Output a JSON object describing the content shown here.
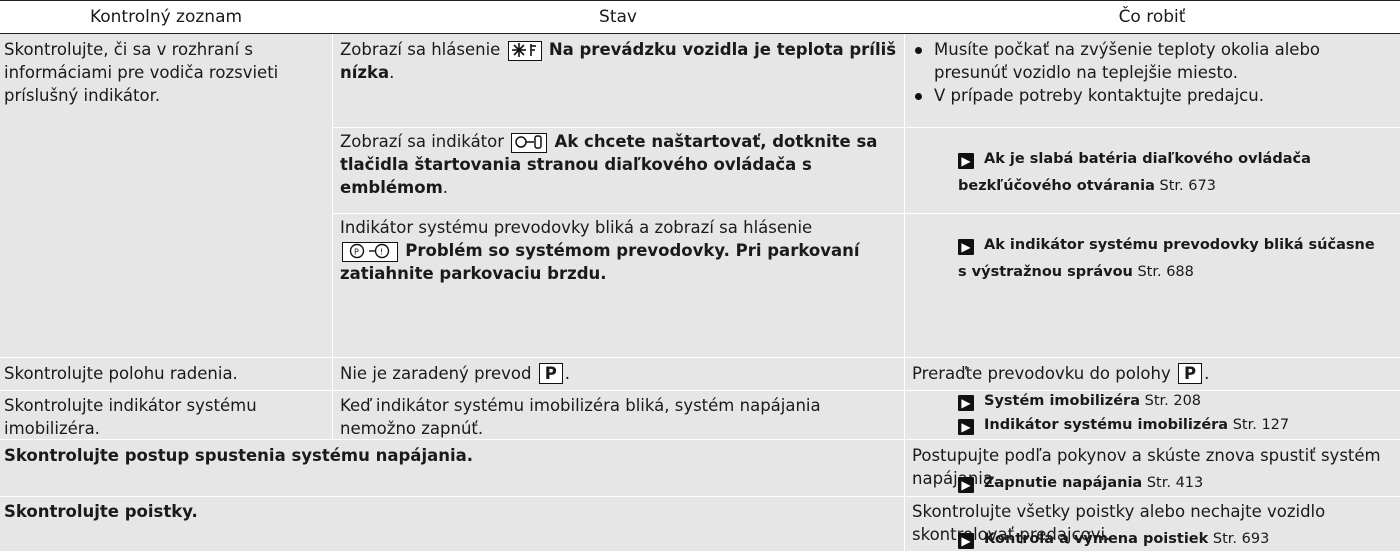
{
  "header": {
    "col1": "Kontrolný zoznam",
    "col2": "Stav",
    "col3": "Čo robiť"
  },
  "row1": {
    "check": "Skontrolujte, či sa v rozhraní s informáciami pre vodiča rozsvieti príslušný indikátor.",
    "sub1": {
      "state_prefix": "Zobrazí sa hlásenie",
      "state_bold": "Na prevádzku vozidla je teplota príliš nízka",
      "state_suffix": ".",
      "action1": "Musíte počkať na zvýšenie teploty okolia alebo presunúť vozidlo na teplejšie miesto.",
      "action2": "V prípade potreby kontaktujte predajcu."
    },
    "sub2": {
      "state_prefix": "Zobrazí sa indikátor",
      "state_bold": "Ak chcete naštartovať, dotknite sa tlačidla štartovania stranou diaľkového ovládača s emblémom",
      "state_suffix": ".",
      "ref_title": "Ak je slabá batéria diaľkového ovládača bezkľúčového otvárania",
      "ref_page": "Str. 673"
    },
    "sub3": {
      "state_prefix": "Indikátor systému prevodovky bliká a zobrazí sa hlásenie",
      "state_bold": "Problém so systémom prevodovky. Pri parkovaní zatiahnite parkovaciu brzdu.",
      "ref_title": "Ak indikátor systému prevodovky bliká súčasne s výstražnou správou",
      "ref_page": "Str. 688"
    }
  },
  "row2": {
    "check": "Skontrolujte polohu radenia.",
    "state_prefix": "Nie je zaradený prevod",
    "gear": "P",
    "state_suffix": ".",
    "action_prefix": "Preraďte prevodovku do polohy",
    "action_suffix": "."
  },
  "row3": {
    "check": "Skontrolujte indikátor systému imobilizéra.",
    "state": "Keď indikátor systému imobilizéra bliká, systém napájania nemožno zapnúť.",
    "ref1_title": "Systém imobilizéra",
    "ref1_page": "Str. 208",
    "ref2_title": "Indikátor systému imobilizéra",
    "ref2_page": "Str. 127"
  },
  "row4": {
    "check": "Skontrolujte postup spustenia systému napájania.",
    "action": "Postupujte podľa pokynov a skúste znova spustiť systém napájania.",
    "ref_title": "Zapnutie napájania",
    "ref_page": "Str. 413"
  },
  "row5": {
    "check": "Skontrolujte poistky.",
    "action": "Skontrolujte všetky poistky alebo nechajte vozidlo skontrolovať predajcovi.",
    "ref_title": "Kontrola a výmena poistiek",
    "ref_page": "Str. 693"
  }
}
